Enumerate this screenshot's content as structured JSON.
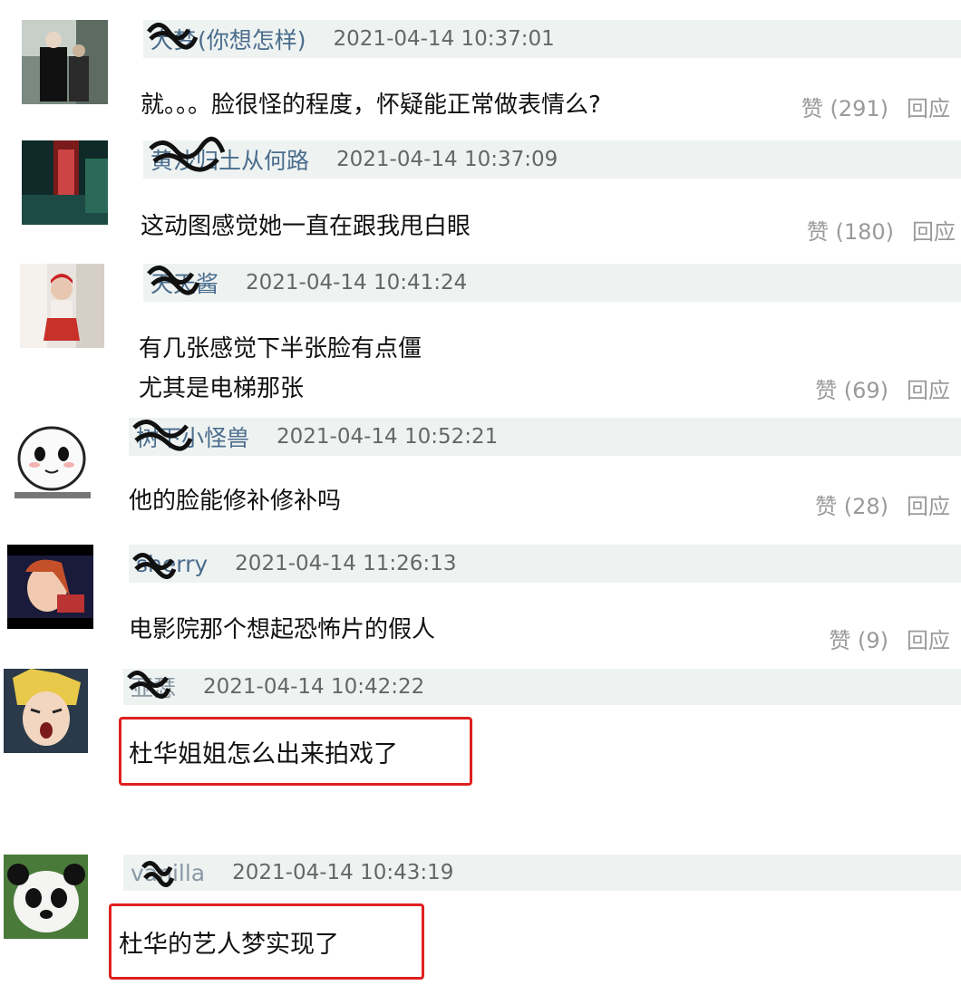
{
  "comments": [
    {
      "username": "大梦",
      "handle": "(你想怎样)",
      "time": "2021-04-14 10:37:01",
      "text": [
        "就。。。脸很怪的程度，怀疑能正常做表情么?"
      ],
      "like": "赞 (291)",
      "reply": "回应"
    },
    {
      "username": "黄沙归土从何路",
      "handle": "",
      "time": "2021-04-14 10:37:09",
      "text": [
        "这动图感觉她一直在跟我甩白眼"
      ],
      "like": "赞 (180)",
      "reply": "回应"
    },
    {
      "username": "天天酱",
      "handle": "",
      "time": "2021-04-14 10:41:24",
      "text": [
        "有几张感觉下半张脸有点僵",
        "尤其是电梯那张"
      ],
      "like": "赞 (69)",
      "reply": "回应"
    },
    {
      "username": "树下小怪兽",
      "handle": "",
      "time": "2021-04-14 10:52:21",
      "text": [
        "他的脸能修补修补吗"
      ],
      "like": "赞 (28)",
      "reply": "回应"
    },
    {
      "username": "sherry",
      "handle": "",
      "time": "2021-04-14 11:26:13",
      "text": [
        "电影院那个想起恐怖片的假人"
      ],
      "like": "赞 (9)",
      "reply": "回应"
    },
    {
      "username": "亚瑟",
      "handle": "",
      "time": "2021-04-14 10:42:22",
      "text": [
        "杜华姐姐怎么出来拍戏了"
      ],
      "like": "",
      "reply": ""
    },
    {
      "username": "vanilla",
      "handle": "",
      "time": "2021-04-14 10:43:19",
      "text": [
        "杜华的艺人梦实现了"
      ],
      "like": "",
      "reply": ""
    }
  ],
  "colors": {
    "meta_bg": "#eef3f2",
    "username": "#4a6c8c",
    "highlight_border": "#e02020"
  }
}
